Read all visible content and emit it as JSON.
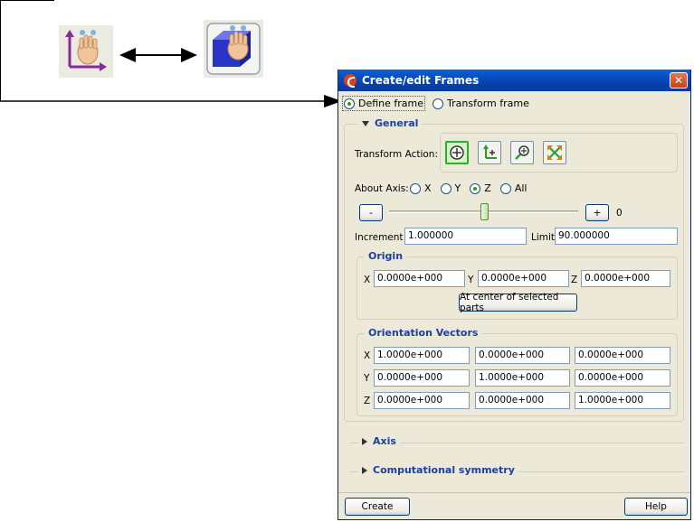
{
  "annotation": {
    "left_icon": "frame-hand-icon",
    "right_icon": "transform-hand-icon",
    "arrow_icon": "double-arrow-icon",
    "pointer_icon": "pointer-arrow-icon"
  },
  "dialog": {
    "title": "Create/edit Frames",
    "close_label": "✕",
    "mode": {
      "options": [
        "Define frame",
        "Transform frame"
      ],
      "selected": "Define frame"
    },
    "general": {
      "title": "General",
      "transform_action_label": "Transform Action:",
      "tools": [
        "rotate-icon",
        "translate-icon",
        "zoom-icon",
        "scale-icon"
      ],
      "about_axis_label": "About Axis:",
      "axes": [
        "X",
        "Y",
        "Z",
        "All"
      ],
      "selected_axis": "Z",
      "minus_label": "-",
      "plus_label": "+",
      "slider_value": "0",
      "slider_position": 0.5,
      "increment_label": "Increment",
      "increment_value": "1.000000",
      "limit_label": "Limit",
      "limit_value": "90.000000"
    },
    "origin": {
      "title": "Origin",
      "x_label": "X",
      "y_label": "Y",
      "z_label": "Z",
      "x": "0.0000e+000",
      "y": "0.0000e+000",
      "z": "0.0000e+000",
      "center_button": "At center of selected parts"
    },
    "orientation": {
      "title": "Orientation Vectors",
      "rows": [
        {
          "label": "X",
          "values": [
            "1.0000e+000",
            "0.0000e+000",
            "0.0000e+000"
          ]
        },
        {
          "label": "Y",
          "values": [
            "0.0000e+000",
            "1.0000e+000",
            "0.0000e+000"
          ]
        },
        {
          "label": "Z",
          "values": [
            "0.0000e+000",
            "0.0000e+000",
            "1.0000e+000"
          ]
        }
      ]
    },
    "axis_section": "Axis",
    "symmetry_section": "Computational symmetry",
    "create_button": "Create",
    "help_button": "Help"
  }
}
